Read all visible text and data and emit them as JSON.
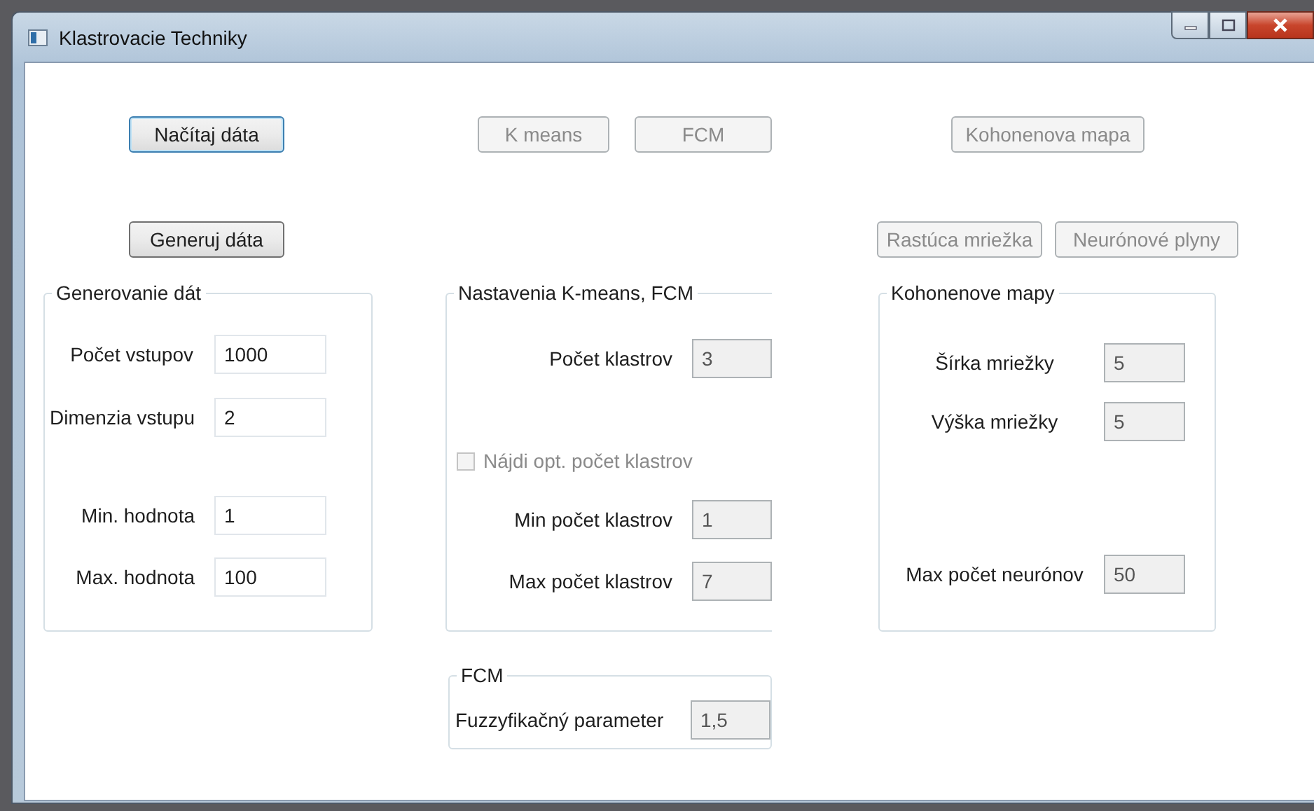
{
  "window": {
    "title": "Klastrovacie Techniky"
  },
  "columns": [
    {
      "buttons": [
        {
          "label": "Načítaj dáta",
          "disabled": false,
          "focused": true
        },
        {
          "label": "Generuj dáta",
          "disabled": false,
          "focused": false
        }
      ],
      "groups": [
        {
          "title": "Generovanie dát",
          "items": [
            {
              "kind": "field",
              "label": "Počet vstupov",
              "value": "1000",
              "disabled": false
            },
            {
              "kind": "field",
              "label": "Dimenzia vstupu",
              "value": "2",
              "disabled": false
            },
            {
              "kind": "field",
              "label": "Min. hodnota",
              "value": "1",
              "disabled": false
            },
            {
              "kind": "field",
              "label": "Max. hodnota",
              "value": "100",
              "disabled": false
            }
          ]
        }
      ]
    },
    {
      "buttons": [
        {
          "label": "K means",
          "disabled": true,
          "focused": false
        },
        {
          "label": "FCM",
          "disabled": true,
          "focused": false
        }
      ],
      "groups": [
        {
          "title": "Nastavenia K-means, FCM",
          "items": [
            {
              "kind": "field",
              "label": "Počet klastrov",
              "value": "3",
              "disabled": true
            },
            {
              "kind": "checkbox",
              "label": "Nájdi opt. počet klastrov",
              "checked": false,
              "disabled": true
            },
            {
              "kind": "field",
              "label": "Min počet klastrov",
              "value": "1",
              "disabled": true
            },
            {
              "kind": "field",
              "label": "Max počet klastrov",
              "value": "7",
              "disabled": true
            }
          ]
        },
        {
          "title": "FCM",
          "items": [
            {
              "kind": "field",
              "label": "Fuzzyfikačný parameter",
              "value": "1,5",
              "disabled": true
            }
          ]
        }
      ]
    },
    {
      "buttons": [
        {
          "label": "Kohonenova mapa",
          "disabled": true,
          "focused": false
        },
        {
          "label": "Rastúca mriežka",
          "disabled": true,
          "focused": false
        },
        {
          "label": "Neurónové plyny",
          "disabled": true,
          "focused": false
        }
      ],
      "groups": [
        {
          "title": "Kohonenove mapy",
          "items": [
            {
              "kind": "field",
              "label": "Šírka mriežky",
              "value": "5",
              "disabled": true
            },
            {
              "kind": "field",
              "label": "Výška mriežky",
              "value": "5",
              "disabled": true
            },
            {
              "kind": "field",
              "label": "Max počet neurónov",
              "value": "50",
              "disabled": true
            }
          ]
        }
      ]
    }
  ]
}
